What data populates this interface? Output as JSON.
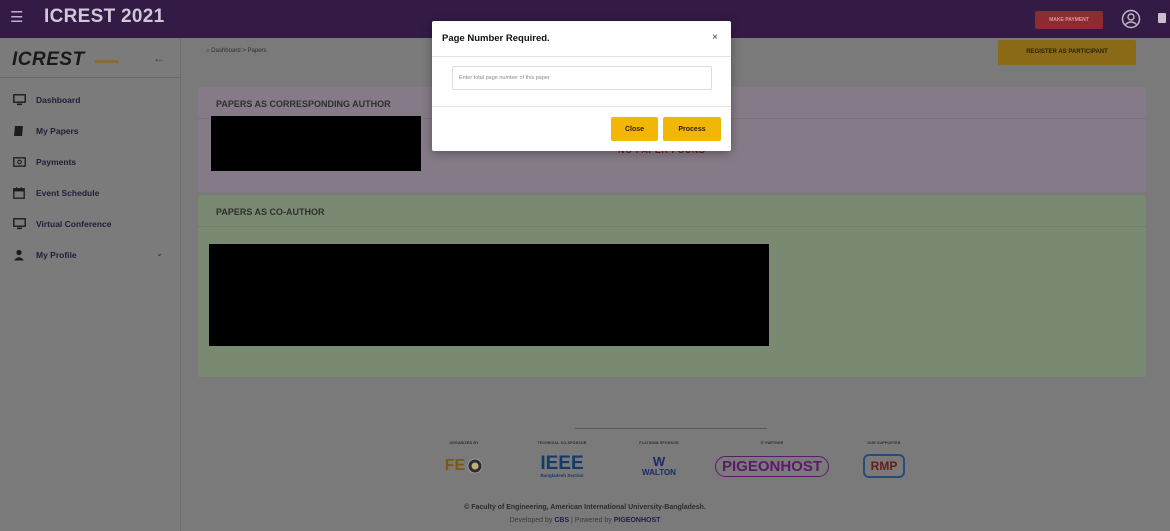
{
  "header": {
    "app_title": "ICREST 2021",
    "make_payment": "MAKE PAYMENT"
  },
  "sidebar": {
    "logo": "ICREST",
    "items": [
      {
        "label": "Dashboard",
        "icon": "monitor-icon"
      },
      {
        "label": "My Papers",
        "icon": "book-icon"
      },
      {
        "label": "Payments",
        "icon": "money-icon"
      },
      {
        "label": "Event Schedule",
        "icon": "calendar-icon"
      },
      {
        "label": "Virtual Conference",
        "icon": "monitor-icon"
      },
      {
        "label": "My Profile",
        "icon": "user-icon"
      }
    ]
  },
  "breadcrumb": {
    "home": "Dashboard",
    "separator": ">",
    "current": "Papers"
  },
  "register_button": "REGISTER AS PARTICIPANT",
  "sections": {
    "corresponding": {
      "title": "PAPERS AS CORRESPONDING AUTHOR",
      "empty_text": "NO PAPER FOUND"
    },
    "coauthor": {
      "title": "PAPERS AS CO-AUTHOR"
    }
  },
  "modal": {
    "title": "Page Number Required.",
    "close_symbol": "×",
    "input_placeholder": "Enter total page number of this paper",
    "close_button": "Close",
    "process_button": "Process"
  },
  "footer": {
    "sponsors": [
      {
        "caption": "ORGANIZED BY",
        "logo": "FE"
      },
      {
        "caption": "TECHNICAL CO-SPONSOR",
        "logo": "IEEE",
        "sub": "Bangladesh Section"
      },
      {
        "caption": "PLATINUM SPONSOR",
        "logo": "WALTON"
      },
      {
        "caption": "IT PARTNER",
        "logo": "PIGEONHOST"
      },
      {
        "caption": "OUR SUPPORTER",
        "logo": "RMP"
      }
    ],
    "copyright": "© Faculty of Engineering, American International University-Bangladesh.",
    "developed_prefix": "Developed by ",
    "developer": "CBS",
    "powered_prefix": " | Powered by ",
    "powered_by": "PIGEONHOST"
  },
  "colors": {
    "topbar": "#331b45",
    "accent": "#f2b705",
    "danger": "#8c2b32"
  }
}
